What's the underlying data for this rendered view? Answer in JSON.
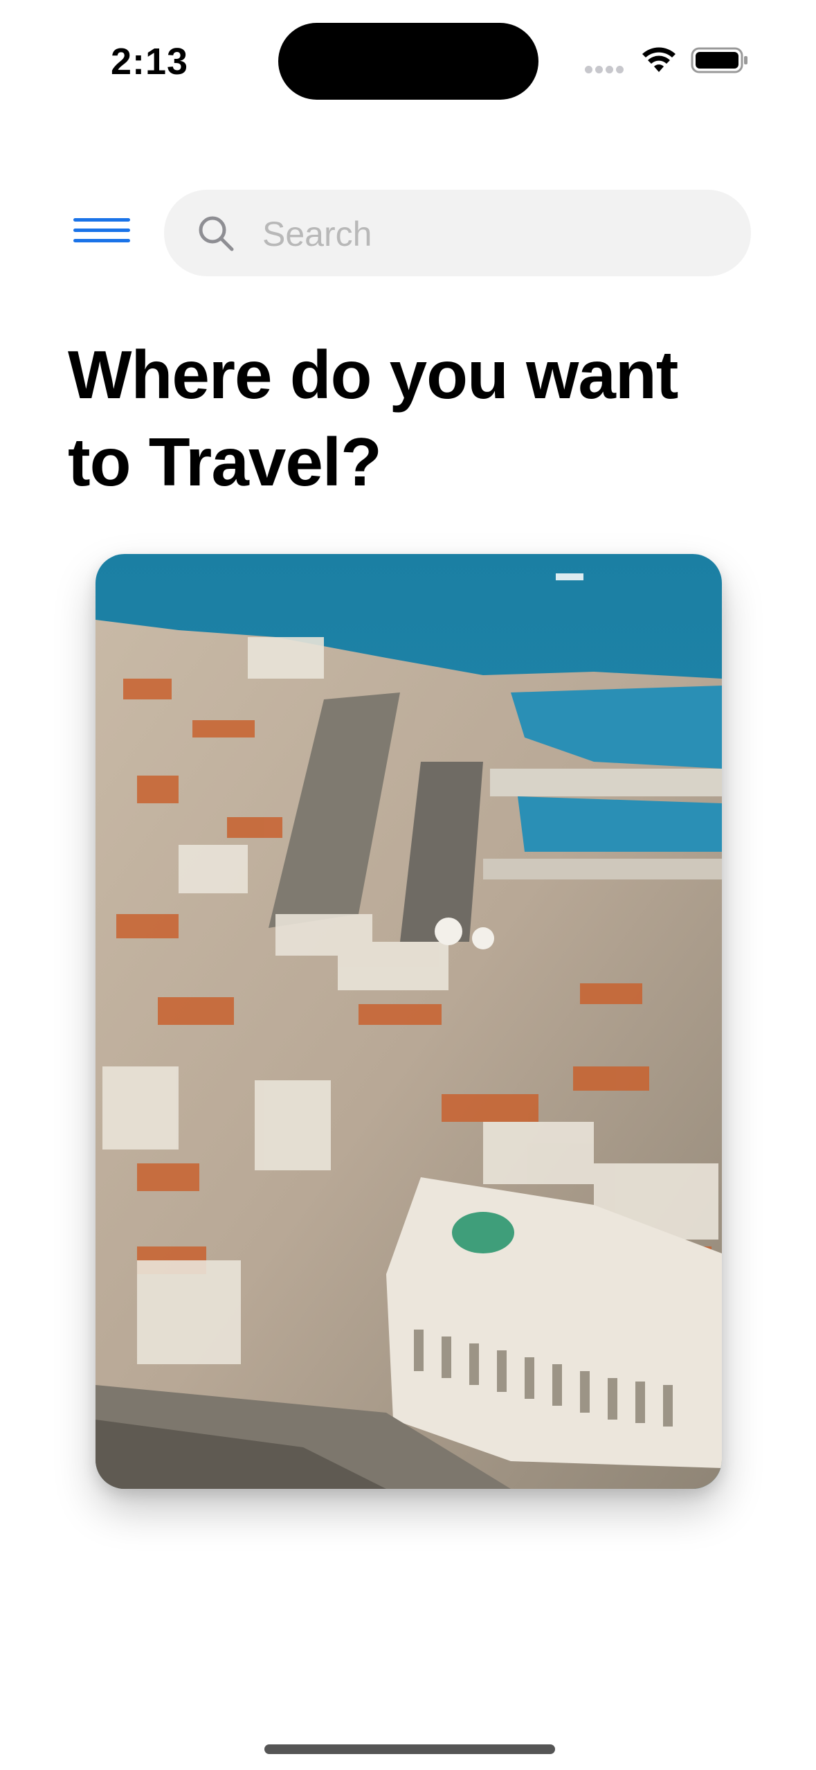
{
  "status_bar": {
    "time": "2:13",
    "icons": [
      "cellular-dots-icon",
      "wifi-icon",
      "battery-icon"
    ]
  },
  "header": {
    "menu_icon": "hamburger-menu-icon",
    "menu_color": "#1a73e8",
    "search": {
      "placeholder": "Search",
      "value": "",
      "icon": "search-icon"
    }
  },
  "main": {
    "title": "Where do you want to Travel?",
    "card": {
      "image_icon": "city-aerial-photo"
    }
  }
}
